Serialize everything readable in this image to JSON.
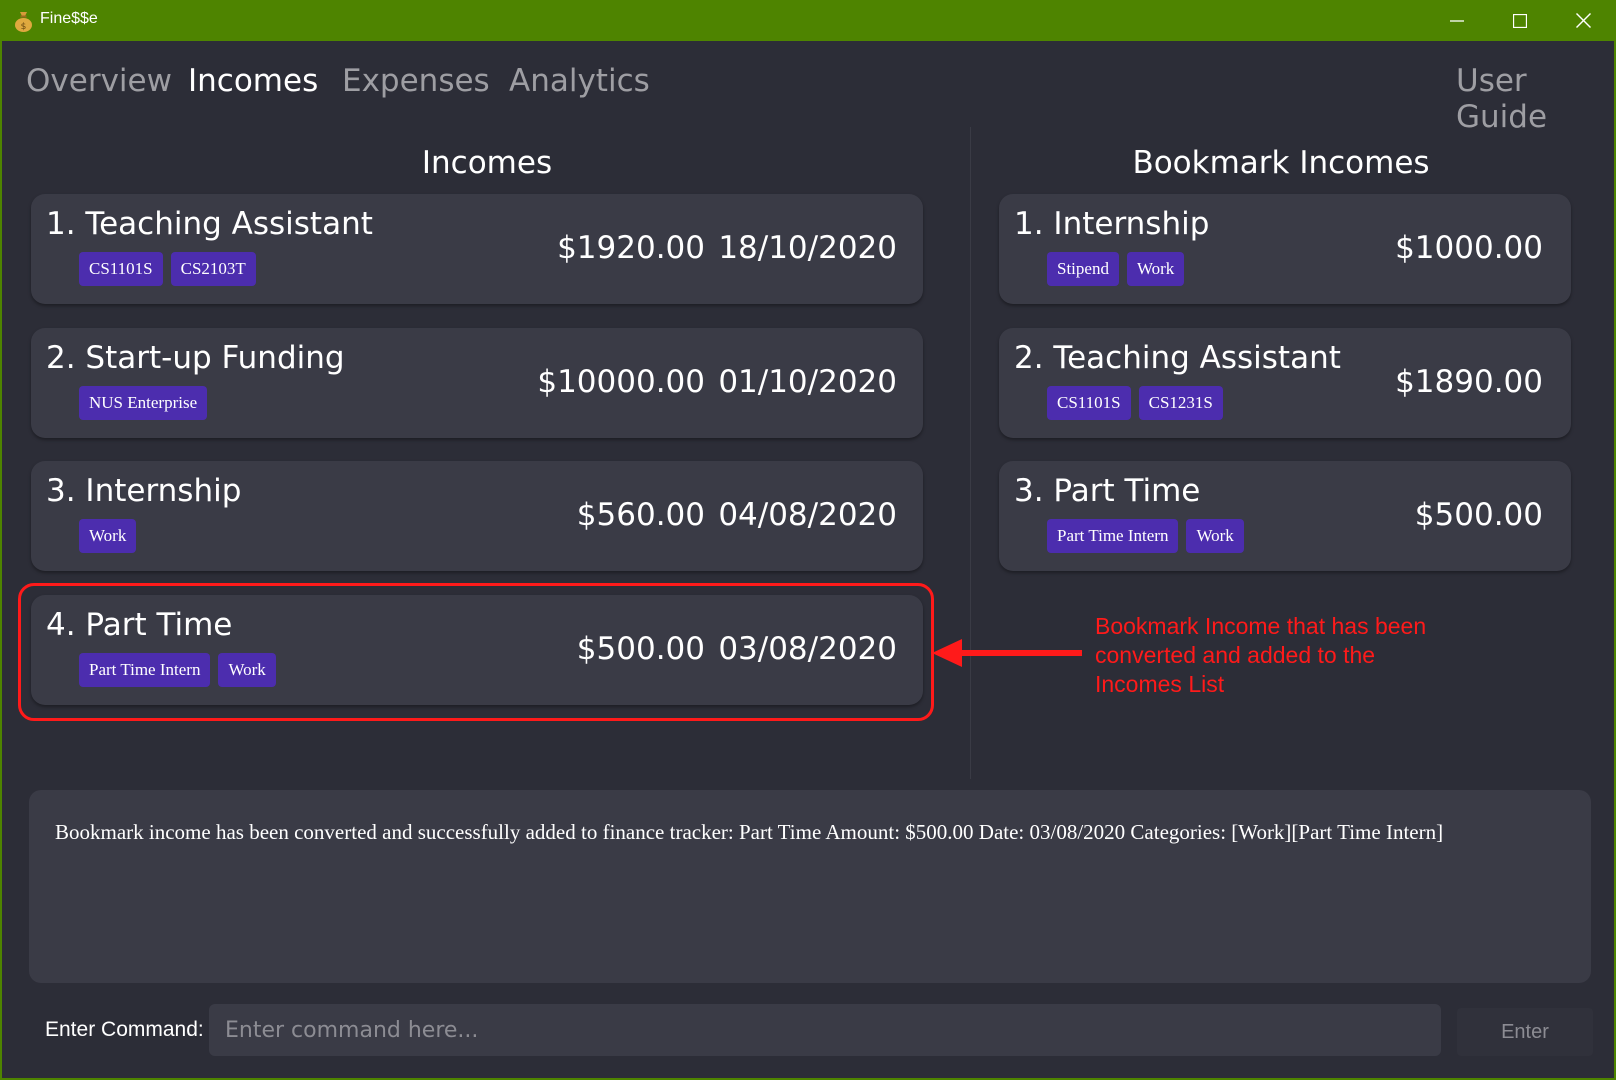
{
  "window": {
    "title": "Fine$$e"
  },
  "tabs": [
    {
      "label": "Overview"
    },
    {
      "label": "Incomes"
    },
    {
      "label": "Expenses"
    },
    {
      "label": "Analytics"
    }
  ],
  "user_guide": "User Guide",
  "incomes": {
    "title": "Incomes",
    "items": [
      {
        "name": "1. Teaching Assistant",
        "tags": [
          "CS1101S",
          "CS2103T"
        ],
        "amount": "$1920.00",
        "date": "18/10/2020"
      },
      {
        "name": "2. Start-up Funding",
        "tags": [
          "NUS Enterprise"
        ],
        "amount": "$10000.00",
        "date": "01/10/2020"
      },
      {
        "name": "3. Internship",
        "tags": [
          "Work"
        ],
        "amount": "$560.00",
        "date": "04/08/2020"
      },
      {
        "name": "4. Part Time",
        "tags": [
          "Part Time Intern",
          "Work"
        ],
        "amount": "$500.00",
        "date": "03/08/2020"
      }
    ]
  },
  "bookmarks": {
    "title": "Bookmark Incomes",
    "items": [
      {
        "name": "1. Internship",
        "tags": [
          "Stipend",
          "Work"
        ],
        "amount": "$1000.00"
      },
      {
        "name": "2. Teaching Assistant",
        "tags": [
          "CS1101S",
          "CS1231S"
        ],
        "amount": "$1890.00"
      },
      {
        "name": "3. Part Time",
        "tags": [
          "Part Time Intern",
          "Work"
        ],
        "amount": "$500.00"
      }
    ]
  },
  "annotation": {
    "text": "Bookmark Income that has been converted and added to the Incomes List"
  },
  "result": {
    "text": "Bookmark income has been converted and successfully added to finance tracker: Part Time Amount: $500.00 Date: 03/08/2020 Categories: [Work][Part Time Intern]"
  },
  "command": {
    "label": "Enter Command:",
    "placeholder": "Enter command here...",
    "value": "",
    "button": "Enter"
  },
  "colors": {
    "titlebar": "#4e8400",
    "background": "#2c2d37",
    "card": "#3a3b46",
    "tag": "#4c2dae",
    "highlight": "#ff1a1a"
  },
  "icons": {
    "app": "money-bag-icon",
    "minimize": "minimize-icon",
    "maximize": "maximize-icon",
    "close": "close-icon",
    "arrow": "arrow-left-icon"
  }
}
